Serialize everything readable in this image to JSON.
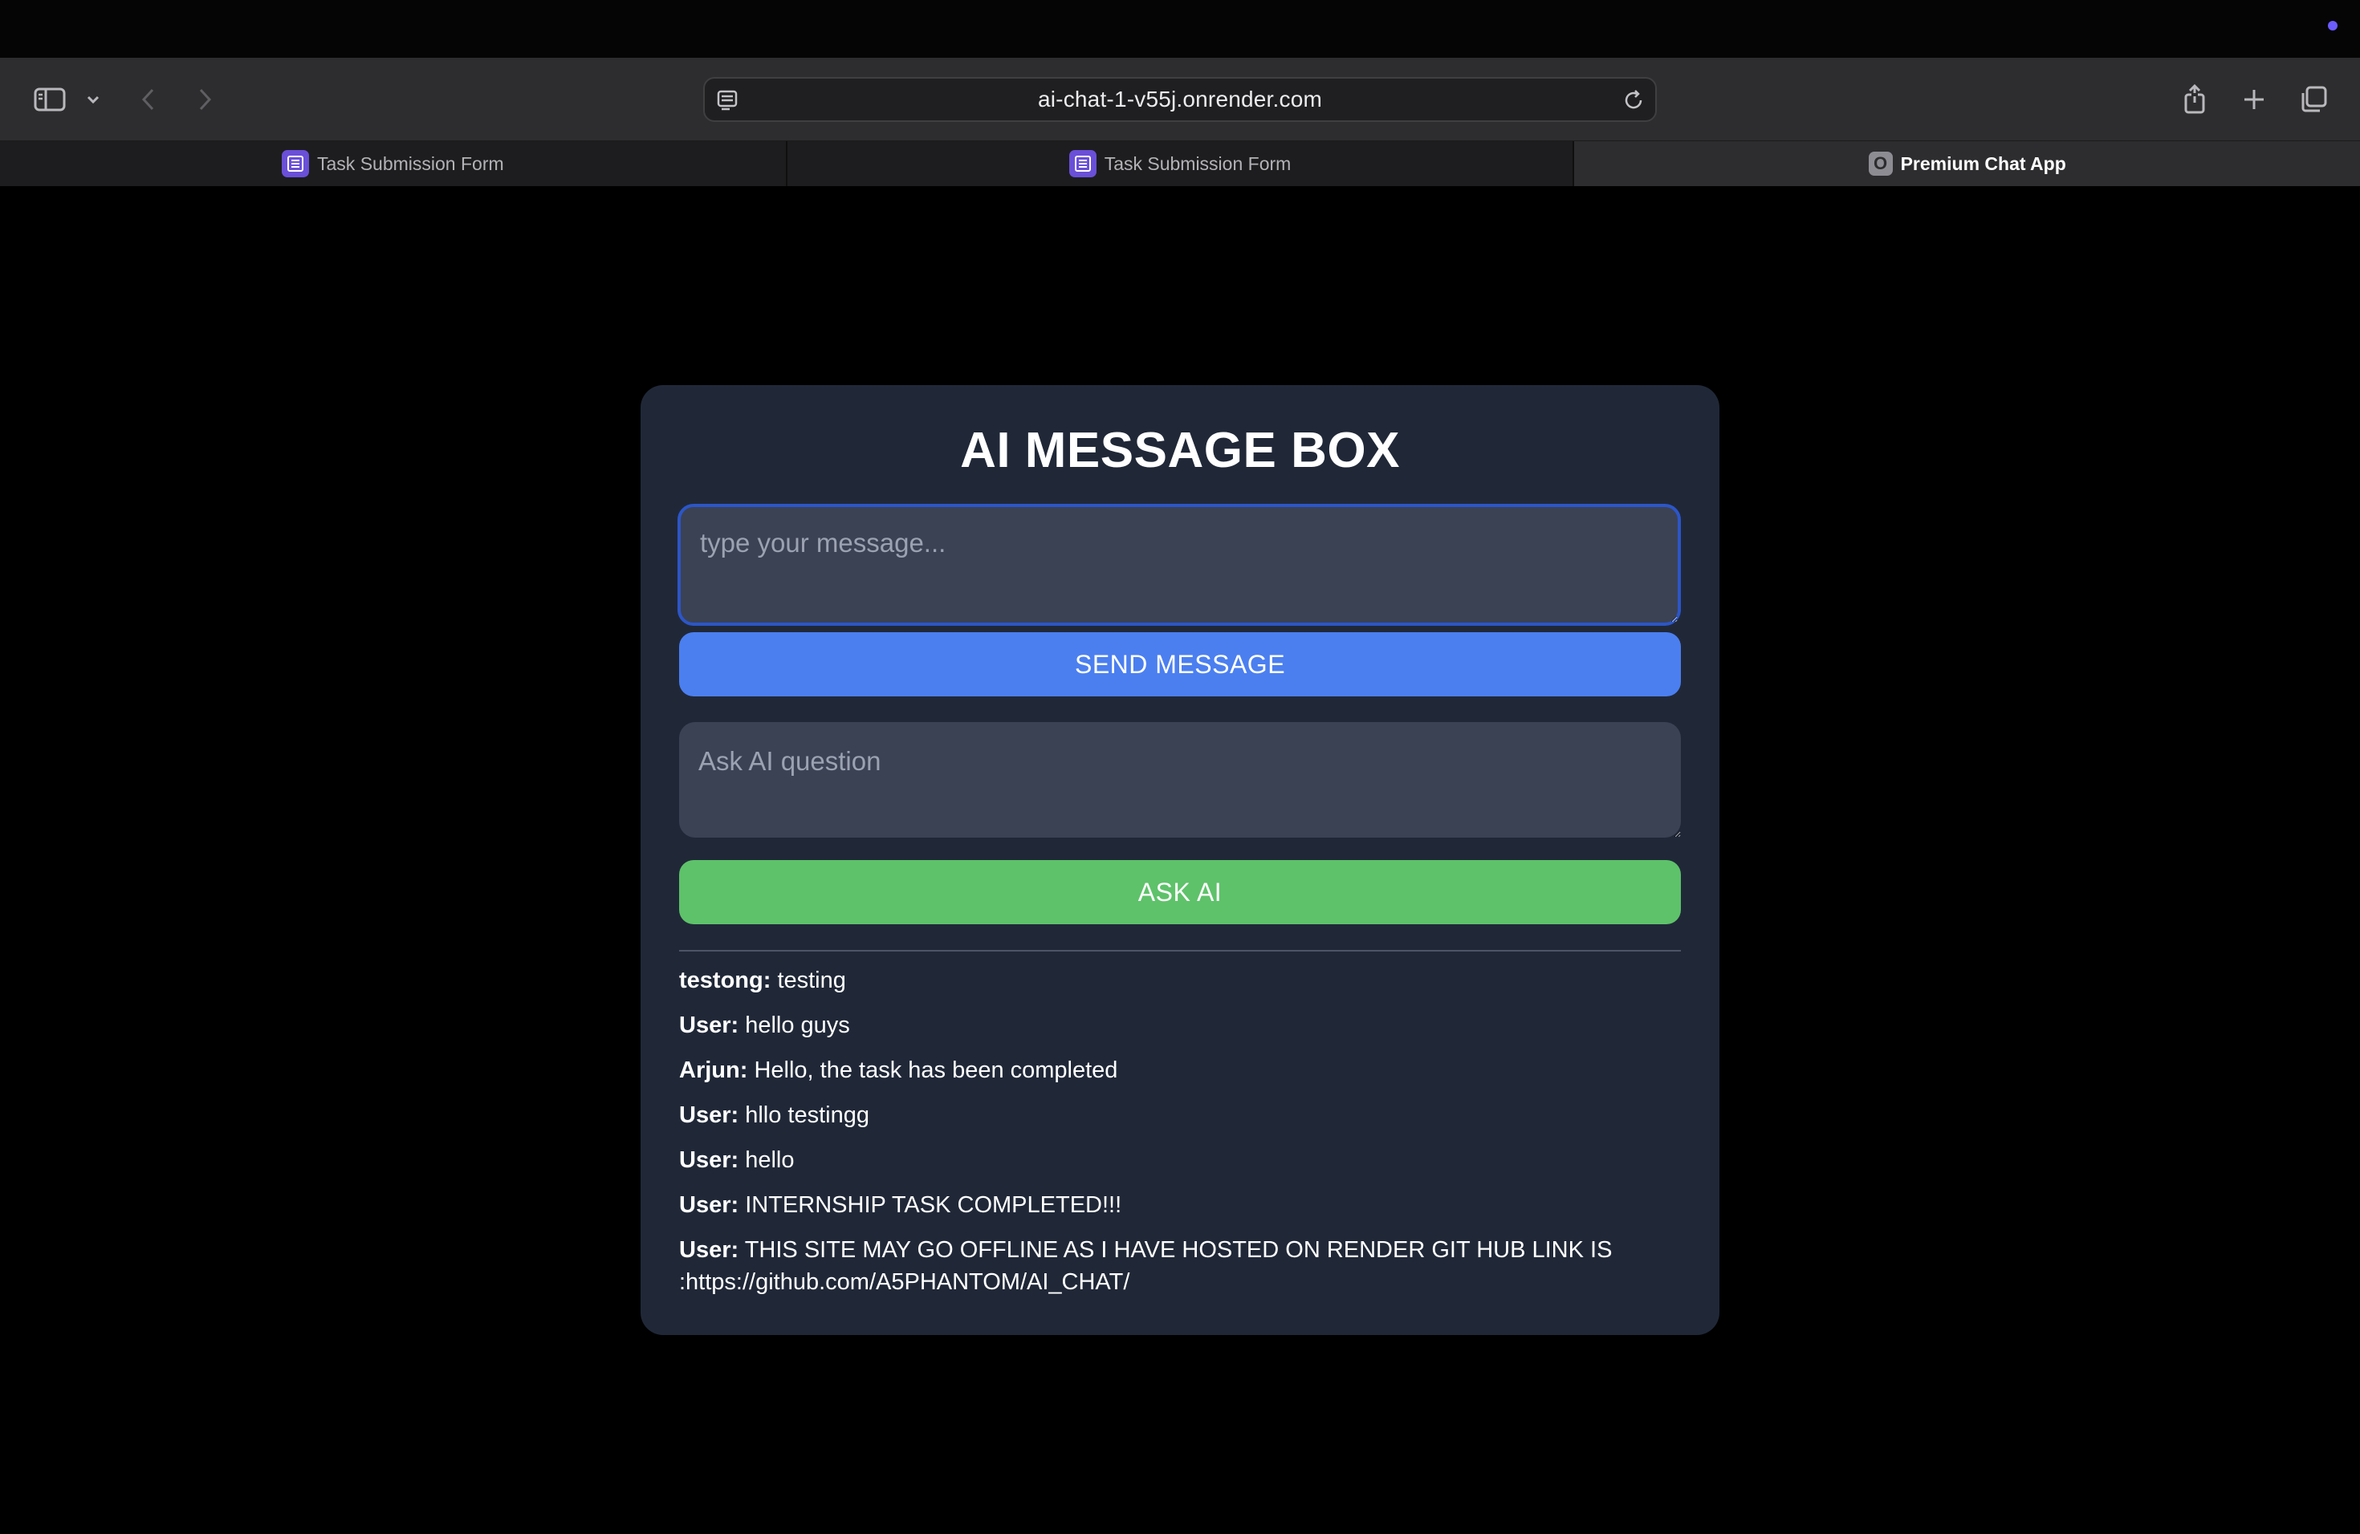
{
  "browser": {
    "url": "ai-chat-1-v55j.onrender.com",
    "tabs": [
      {
        "label": "Task Submission Form",
        "favicon": "form-list-icon",
        "active": false
      },
      {
        "label": "Task Submission Form",
        "favicon": "form-list-icon",
        "active": false
      },
      {
        "label": "Premium Chat App",
        "favicon_letter": "O",
        "active": true
      }
    ]
  },
  "app": {
    "title": "AI MESSAGE BOX",
    "message_input": {
      "placeholder": "type your message...",
      "value": ""
    },
    "send_label": "SEND MESSAGE",
    "ai_input": {
      "placeholder": "Ask AI question",
      "value": ""
    },
    "ask_label": "ASK AI",
    "messages": [
      {
        "sender": "testong:",
        "text": "testing"
      },
      {
        "sender": "User:",
        "text": "hello guys"
      },
      {
        "sender": "Arjun:",
        "text": "Hello, the task has been completed"
      },
      {
        "sender": "User:",
        "text": "hllo testingg"
      },
      {
        "sender": "User:",
        "text": "hello"
      },
      {
        "sender": "User:",
        "text": "INTERNSHIP TASK COMPLETED!!!"
      },
      {
        "sender": "User:",
        "text": "THIS SITE MAY GO OFFLINE AS I HAVE HOSTED ON RENDER GIT HUB LINK IS :https://github.com/A5PHANTOM/AI_CHAT/"
      }
    ]
  },
  "colors": {
    "card_bg": "#202838",
    "input_bg": "#3b4254",
    "send_button": "#4b7ff0",
    "ask_button": "#5ec26a",
    "focus_border": "#2c56c8"
  }
}
